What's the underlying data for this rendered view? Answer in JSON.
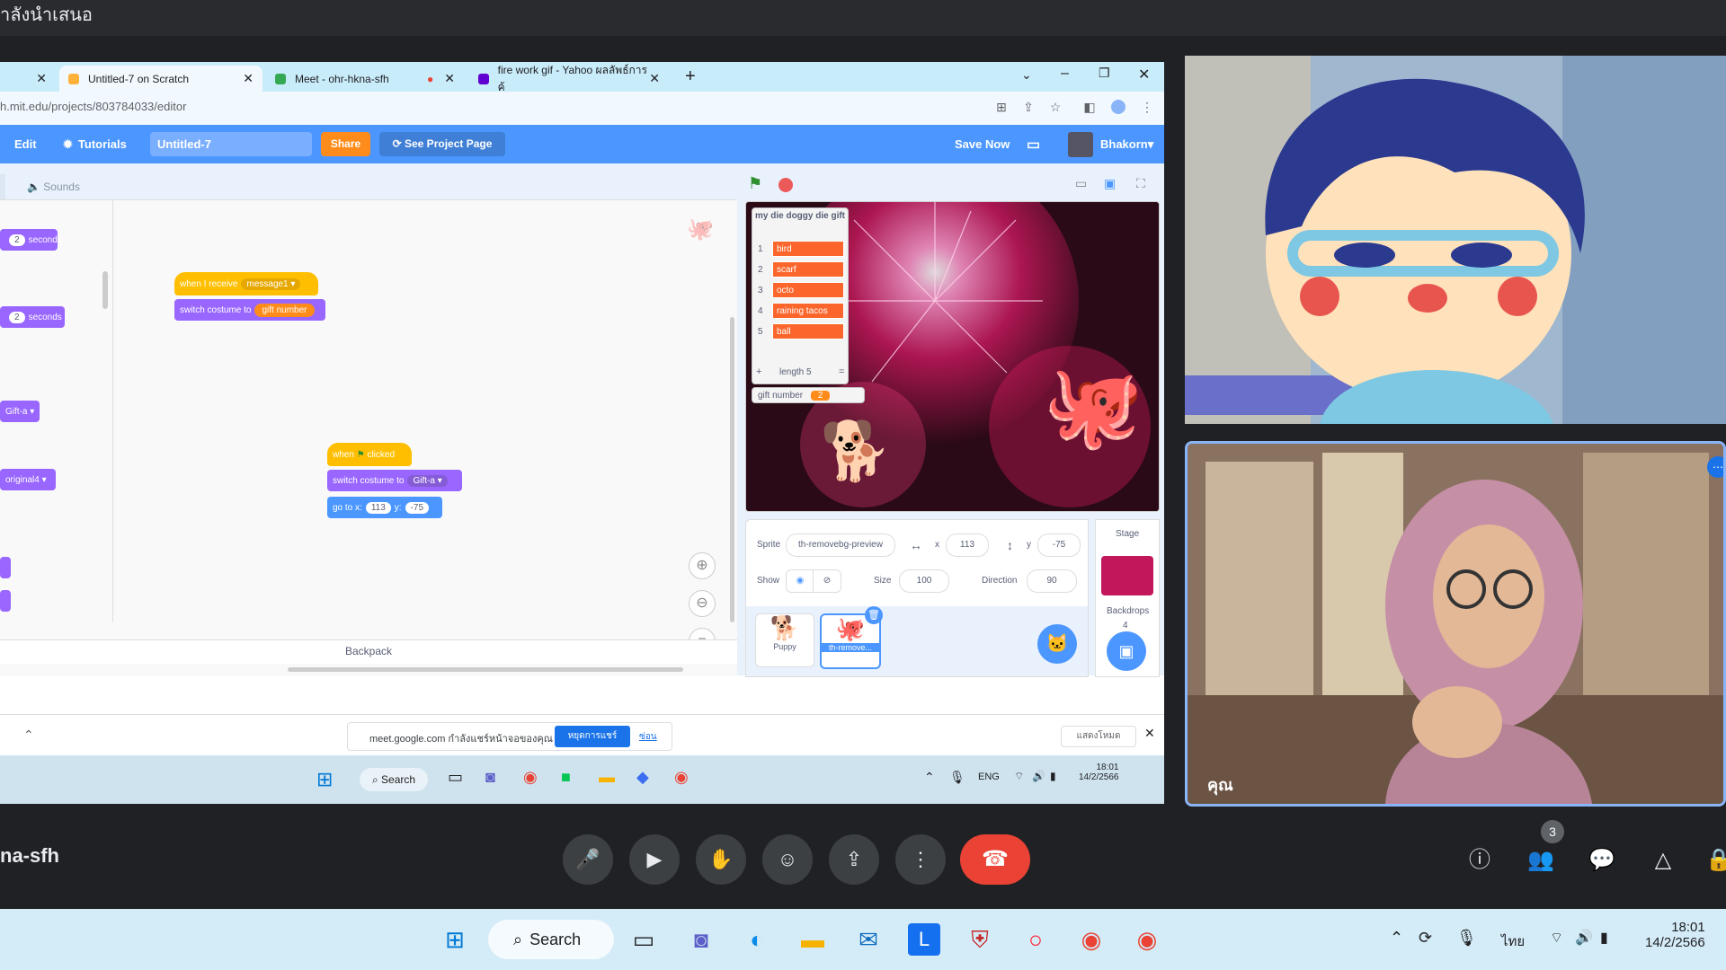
{
  "meet": {
    "presenting_label": "ำลังนำเสนอ",
    "meeting_code": "na-sfh",
    "participants_count": "3",
    "self_label": "คุณ"
  },
  "browser": {
    "tabs": [
      {
        "label": "Untitled-7 on Scratch",
        "active": true
      },
      {
        "label": "Meet - ohr-hkna-sfh",
        "active": false
      },
      {
        "label": "fire work gif - Yahoo ผลลัพธ์การค้",
        "active": false
      }
    ],
    "url": "h.mit.edu/projects/803784033/editor"
  },
  "scratch": {
    "menu": {
      "edit": "Edit",
      "tutorials": "Tutorials",
      "title": "Untitled-7",
      "share": "Share",
      "see_project": "See Project Page",
      "save_now": "Save Now",
      "user": "Bhakorn"
    },
    "tabs": {
      "sounds": "Sounds"
    },
    "palette": {
      "seconds1": "seconds",
      "seconds2": "seconds",
      "val1": "2",
      "val2": "2",
      "gift": "Gift-a",
      "orig": "original4"
    },
    "scripts": {
      "when_receive": "when I receive",
      "message": "message1",
      "switch_costume": "switch costume to",
      "gift_number": "gift number",
      "when_flag": "when",
      "clicked": "clicked",
      "switch2": "switch costume to",
      "gift_a": "Gift-a",
      "goto": "go to x:",
      "x": "113",
      "y_lbl": "y:",
      "y": "-75"
    },
    "backpack": "Backpack",
    "list_monitor": {
      "title": "my die doggy die gift",
      "items": [
        "bird",
        "scarf",
        "octo",
        "raining tacos",
        "ball"
      ],
      "length": "length 5",
      "plus": "+",
      "eq": "="
    },
    "var_monitor": {
      "name": "gift number",
      "value": "2"
    },
    "sprite_info": {
      "sprite_lbl": "Sprite",
      "sprite_name": "th-removebg-preview",
      "x_lbl": "x",
      "x": "113",
      "y_lbl": "y",
      "y": "-75",
      "show_lbl": "Show",
      "size_lbl": "Size",
      "size": "100",
      "direction_lbl": "Direction",
      "direction": "90"
    },
    "sprites": [
      {
        "name": "Puppy"
      },
      {
        "name": "th-remove..."
      }
    ],
    "stage": {
      "label": "Stage",
      "backdrops_lbl": "Backdrops",
      "backdrops": "4"
    }
  },
  "download_bar": {
    "text": "meet.google.com กำลังแชร์หน้าจอของคุณ",
    "stop": "หยุดการแชร์",
    "hide": "ซ่อน",
    "show": "แสดงโหมด"
  },
  "inner_taskbar": {
    "search": "Search",
    "lang": "ENG",
    "time": "18:01",
    "date": "14/2/2566"
  },
  "taskbar": {
    "search": "Search",
    "lang": "ไทย",
    "time": "18:01",
    "date": "14/2/2566"
  },
  "colors": {
    "scratch_blue": "#4c97ff",
    "end_call": "#ea4335",
    "orange": "#ff8c1a"
  }
}
